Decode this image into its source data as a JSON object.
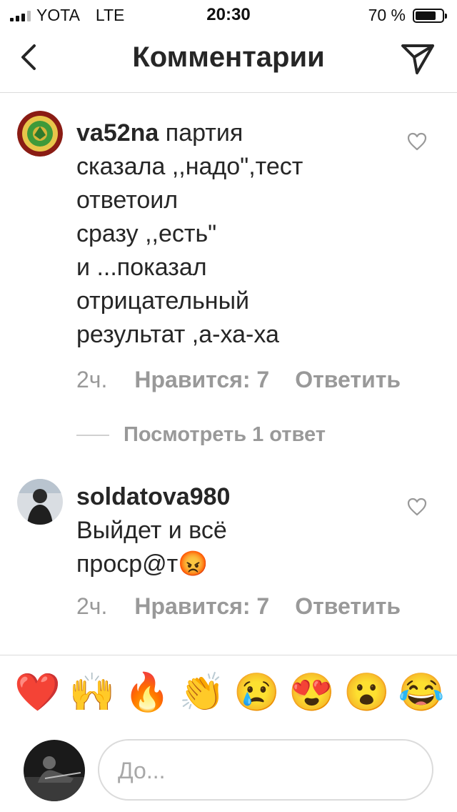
{
  "status_bar": {
    "carrier": "YOTA",
    "network": "LTE",
    "time": "20:30",
    "battery": "70 %",
    "battery_level": 0.7
  },
  "header": {
    "title": "Комментарии",
    "back_icon": "chevron-left-icon",
    "send_icon": "paper-plane-icon"
  },
  "comments": [
    {
      "username": "va52na",
      "text": "партия\nсказала ,,надо\",тест\nответоил\nсразу ,,есть\"\nи ...показал\nотрицательный\nрезультат ,а-ха-ха",
      "time": "2ч.",
      "likes": "Нравится: 7",
      "reply": "Ответить",
      "view_replies": "Посмотреть 1 ответ"
    },
    {
      "username": "soldatova980",
      "text": "Выйдет и всё\nпроср@т😡",
      "time": "2ч.",
      "likes": "Нравится: 7",
      "reply": "Ответить"
    }
  ],
  "emoji_bar": [
    "❤️",
    "🙌",
    "🔥",
    "👏",
    "😢",
    "😍",
    "😮",
    "😂"
  ],
  "input": {
    "placeholder": "До..."
  },
  "colors": {
    "text": "#262626",
    "secondary": "#999999",
    "divider": "#dbdbdb"
  }
}
